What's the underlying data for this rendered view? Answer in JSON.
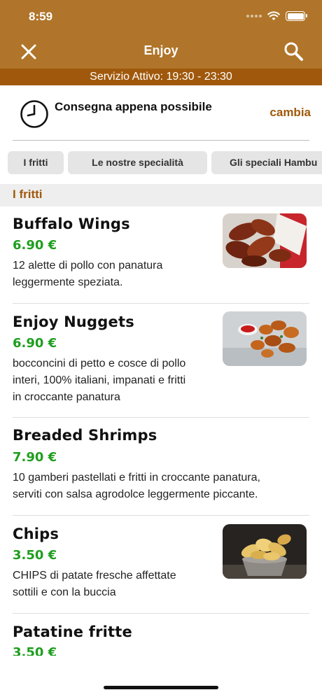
{
  "status_bar": {
    "time": "8:59"
  },
  "nav": {
    "title": "Enjoy",
    "close_icon": "close-icon",
    "search_icon": "search-icon"
  },
  "service_bar": {
    "text": "Servizio Attivo: 19:30 - 23:30"
  },
  "delivery": {
    "text": "Consegna appena possibile",
    "change_label": "cambia",
    "icon": "clock-icon"
  },
  "categories": [
    "I fritti",
    "Le nostre specialità",
    "Gli speciali Hambu"
  ],
  "section": {
    "title": "I fritti"
  },
  "items": [
    {
      "name": "Buffalo Wings",
      "price": "6.90 €",
      "desc": [
        "12 alette di pollo con panatura",
        "leggermente speziata."
      ],
      "image": "wings-photo"
    },
    {
      "name": "Enjoy Nuggets",
      "price": "6.90 €",
      "desc": [
        "bocconcini di petto e cosce di pollo",
        "interi, 100% italiani, impanati e fritti",
        "in croccante panatura"
      ],
      "image": "nuggets-photo"
    },
    {
      "name": "Breaded Shrimps",
      "price": "7.90 €",
      "desc": [
        "10 gamberi pastellati e fritti in croccante panatura,",
        "serviti con salsa agrodolce leggermente piccante."
      ],
      "image": ""
    },
    {
      "name": "Chips",
      "price": "3.50 €",
      "desc": [
        "CHIPS di patate fresche affettate",
        "sottili e con la buccia"
      ],
      "image": "chips-photo"
    },
    {
      "name": "Patatine fritte",
      "price": "3.50 €",
      "desc": [],
      "image": ""
    }
  ],
  "colors": {
    "header": "#b0752a",
    "service_bar": "#a0590c",
    "accent": "#a0590c",
    "price": "#1f9e1f"
  }
}
